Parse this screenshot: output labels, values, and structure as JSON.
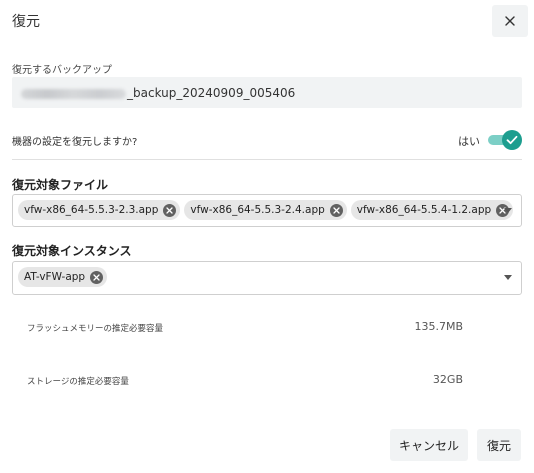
{
  "dialog": {
    "title": "復元",
    "close_icon": "close-icon"
  },
  "backup": {
    "label": "復元するバックアップ",
    "value_visible": "_backup_20240909_005406"
  },
  "restore_settings": {
    "question": "機器の設定を復元しますか?",
    "toggle_label": "はい",
    "toggle_on": true
  },
  "files": {
    "label": "復元対象ファイル",
    "chips": [
      "vfw-x86_64-5.5.3-2.3.app",
      "vfw-x86_64-5.5.3-2.4.app",
      "vfw-x86_64-5.5.4-1.2.app"
    ]
  },
  "instances": {
    "label": "復元対象インスタンス",
    "chips": [
      "AT-vFW-app"
    ]
  },
  "estimates": {
    "flash_label": "フラッシュメモリーの推定必要容量",
    "flash_value": "135.7MB",
    "storage_label": "ストレージの推定必要容量",
    "storage_value": "32GB"
  },
  "buttons": {
    "cancel": "キャンセル",
    "restore": "復元"
  },
  "colors": {
    "accent": "#1d9e8f",
    "accent_light": "#7ccfc6",
    "panel_bg": "#f1f3f4"
  }
}
